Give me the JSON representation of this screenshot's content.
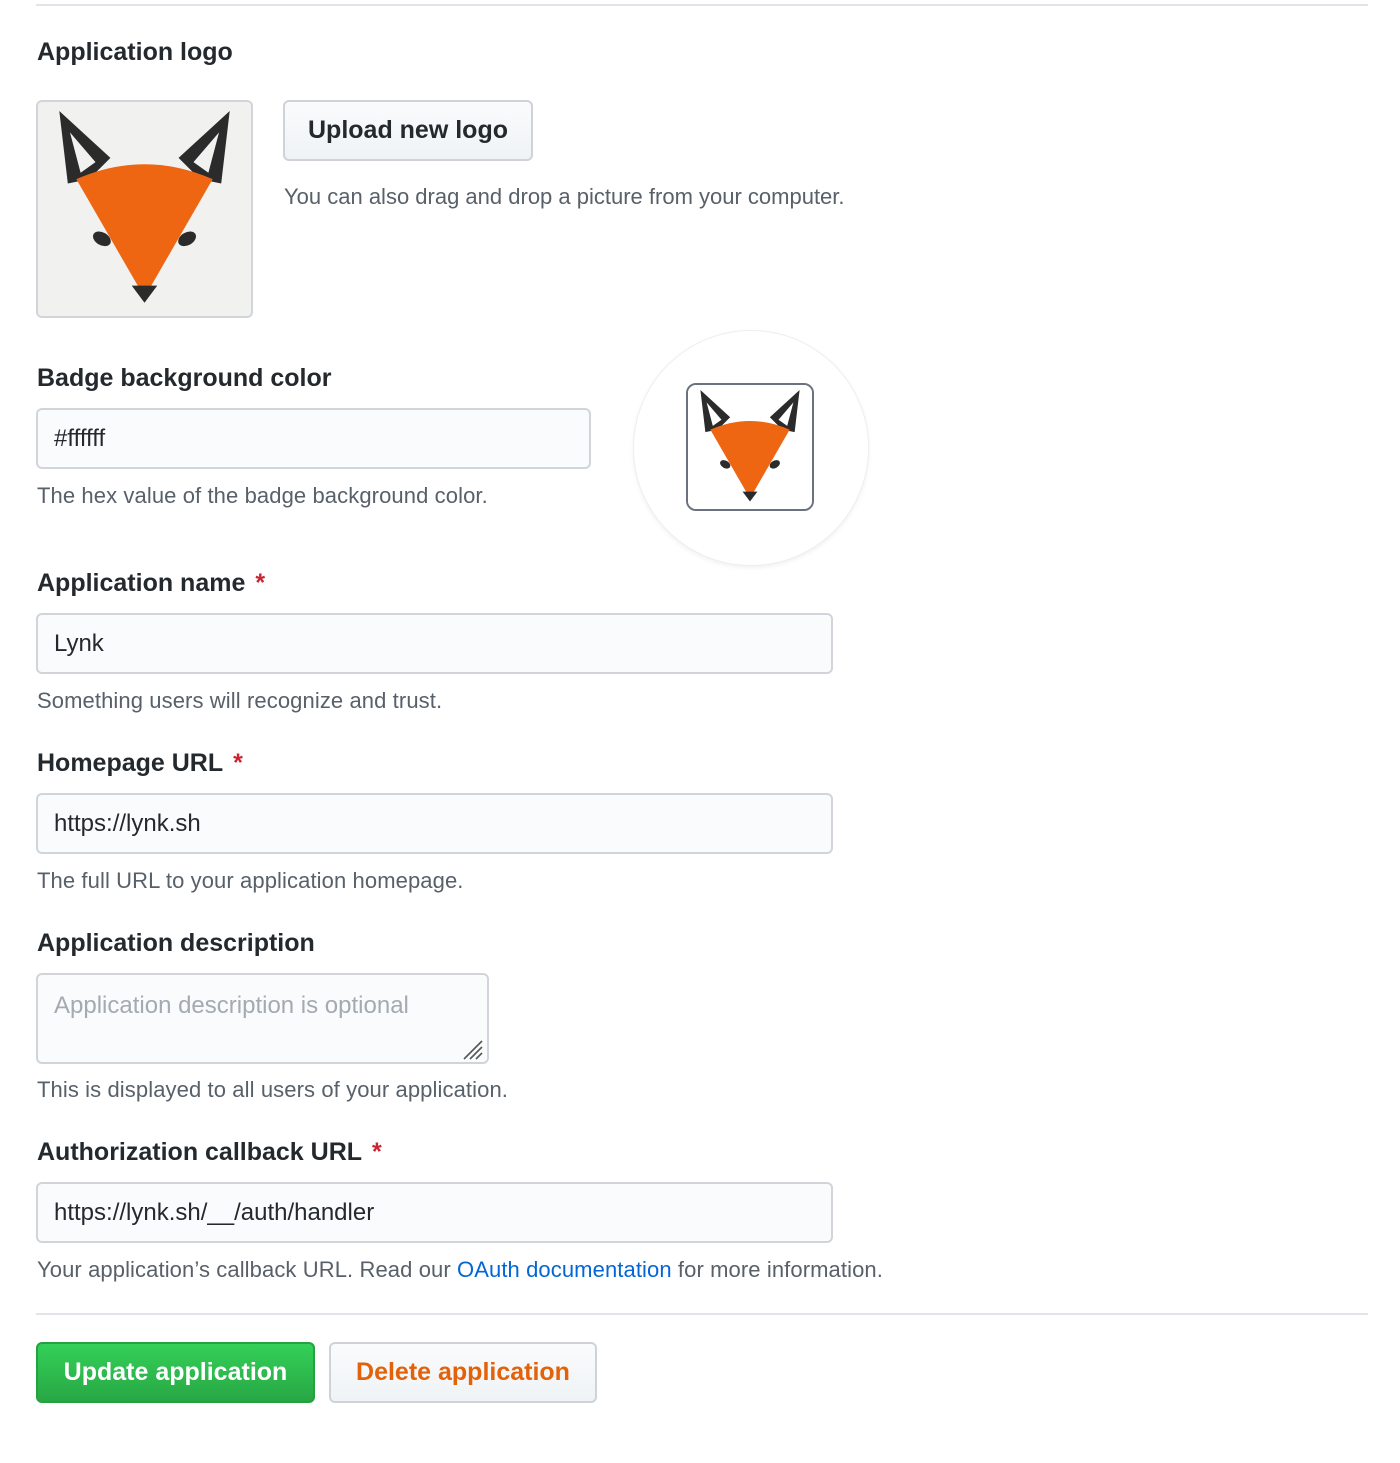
{
  "logo_section": {
    "title": "Application logo",
    "upload_button": "Upload new logo",
    "drag_note": "You can also drag and drop a picture from your computer."
  },
  "badge": {
    "label": "Badge background color",
    "value": "#ffffff",
    "note": "The hex value of the badge background color."
  },
  "app_name": {
    "label": "Application name",
    "required_mark": "*",
    "value": "Lynk",
    "note": "Something users will recognize and trust."
  },
  "homepage": {
    "label": "Homepage URL",
    "required_mark": "*",
    "value": "https://lynk.sh",
    "note": "The full URL to your application homepage."
  },
  "description": {
    "label": "Application description",
    "placeholder": "Application description is optional",
    "note": "This is displayed to all users of your application."
  },
  "callback": {
    "label": "Authorization callback URL",
    "required_mark": "*",
    "value": "https://lynk.sh/__/auth/handler",
    "note_prefix": "Your application’s callback URL. Read our ",
    "note_link": "OAuth documentation",
    "note_suffix": " for more information."
  },
  "actions": {
    "update": "Update application",
    "delete": "Delete application"
  },
  "colors": {
    "fox_orange": "#ee6512",
    "update_green": "#28a745",
    "delete_text": "#e36209",
    "required": "#cb2431",
    "link": "#0366d6"
  },
  "icons": {
    "logo": "fox-logo-icon",
    "resize": "resize-handle-icon"
  }
}
